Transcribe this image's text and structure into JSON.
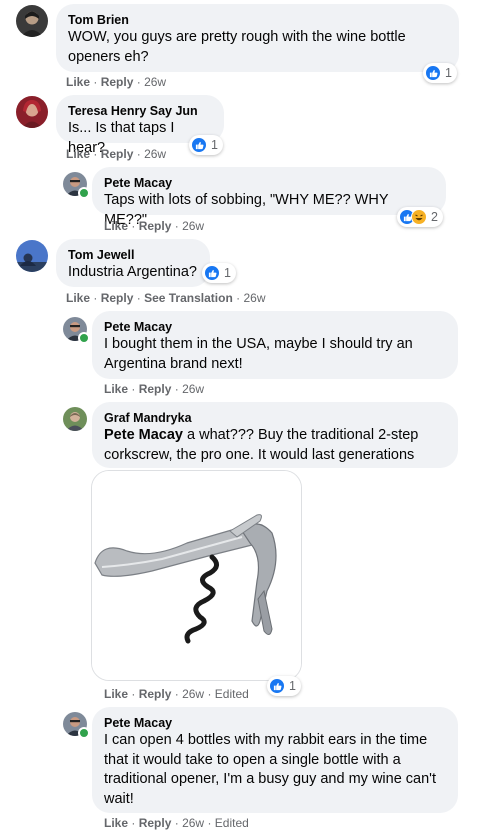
{
  "comments": [
    {
      "author": "Tom Brien",
      "text": "WOW, you guys are pretty rough with the wine bottle openers eh?",
      "like": "Like",
      "reply": "Reply",
      "time": "26w",
      "reaction_count": "1"
    },
    {
      "author": "Teresa Henry Say Jun",
      "text": "Is... Is that taps I hear?",
      "like": "Like",
      "reply": "Reply",
      "time": "26w",
      "reaction_count": "1"
    },
    {
      "author": "Pete Macay",
      "text": "Taps with lots of sobbing, \"WHY ME?? WHY ME??\"",
      "like": "Like",
      "reply": "Reply",
      "time": "26w",
      "reaction_count": "2"
    },
    {
      "author": "Tom Jewell",
      "text": "Industria Argentina?",
      "like": "Like",
      "reply": "Reply",
      "see_translation": "See Translation",
      "time": "26w",
      "reaction_count": "1"
    },
    {
      "author": "Pete Macay",
      "text": "I bought them in the USA, maybe I should try an Argentina brand next!",
      "like": "Like",
      "reply": "Reply",
      "time": "26w"
    },
    {
      "author": "Graf Mandryka",
      "mention": "Pete Macay",
      "text": " a what??? Buy the traditional 2-step corkscrew, the pro one. It would last generations",
      "like": "Like",
      "reply": "Reply",
      "time": "26w",
      "edited": "Edited",
      "reaction_count": "1"
    },
    {
      "author": "Pete Macay",
      "text": "I can open 4 bottles with my rabbit ears in the time that it would take to open a single bottle with a traditional opener, I'm a busy guy and my wine can't wait!",
      "like": "Like",
      "reply": "Reply",
      "time": "26w",
      "edited": "Edited"
    }
  ],
  "separator": "·",
  "icons": {
    "like": "like-reaction-icon",
    "haha": "haha-reaction-icon",
    "online": "online-status-icon"
  },
  "colors": {
    "bubble": "#f0f2f5",
    "meta_text": "#65676b",
    "like_blue": "#1877f2",
    "online_green": "#31a24c"
  }
}
